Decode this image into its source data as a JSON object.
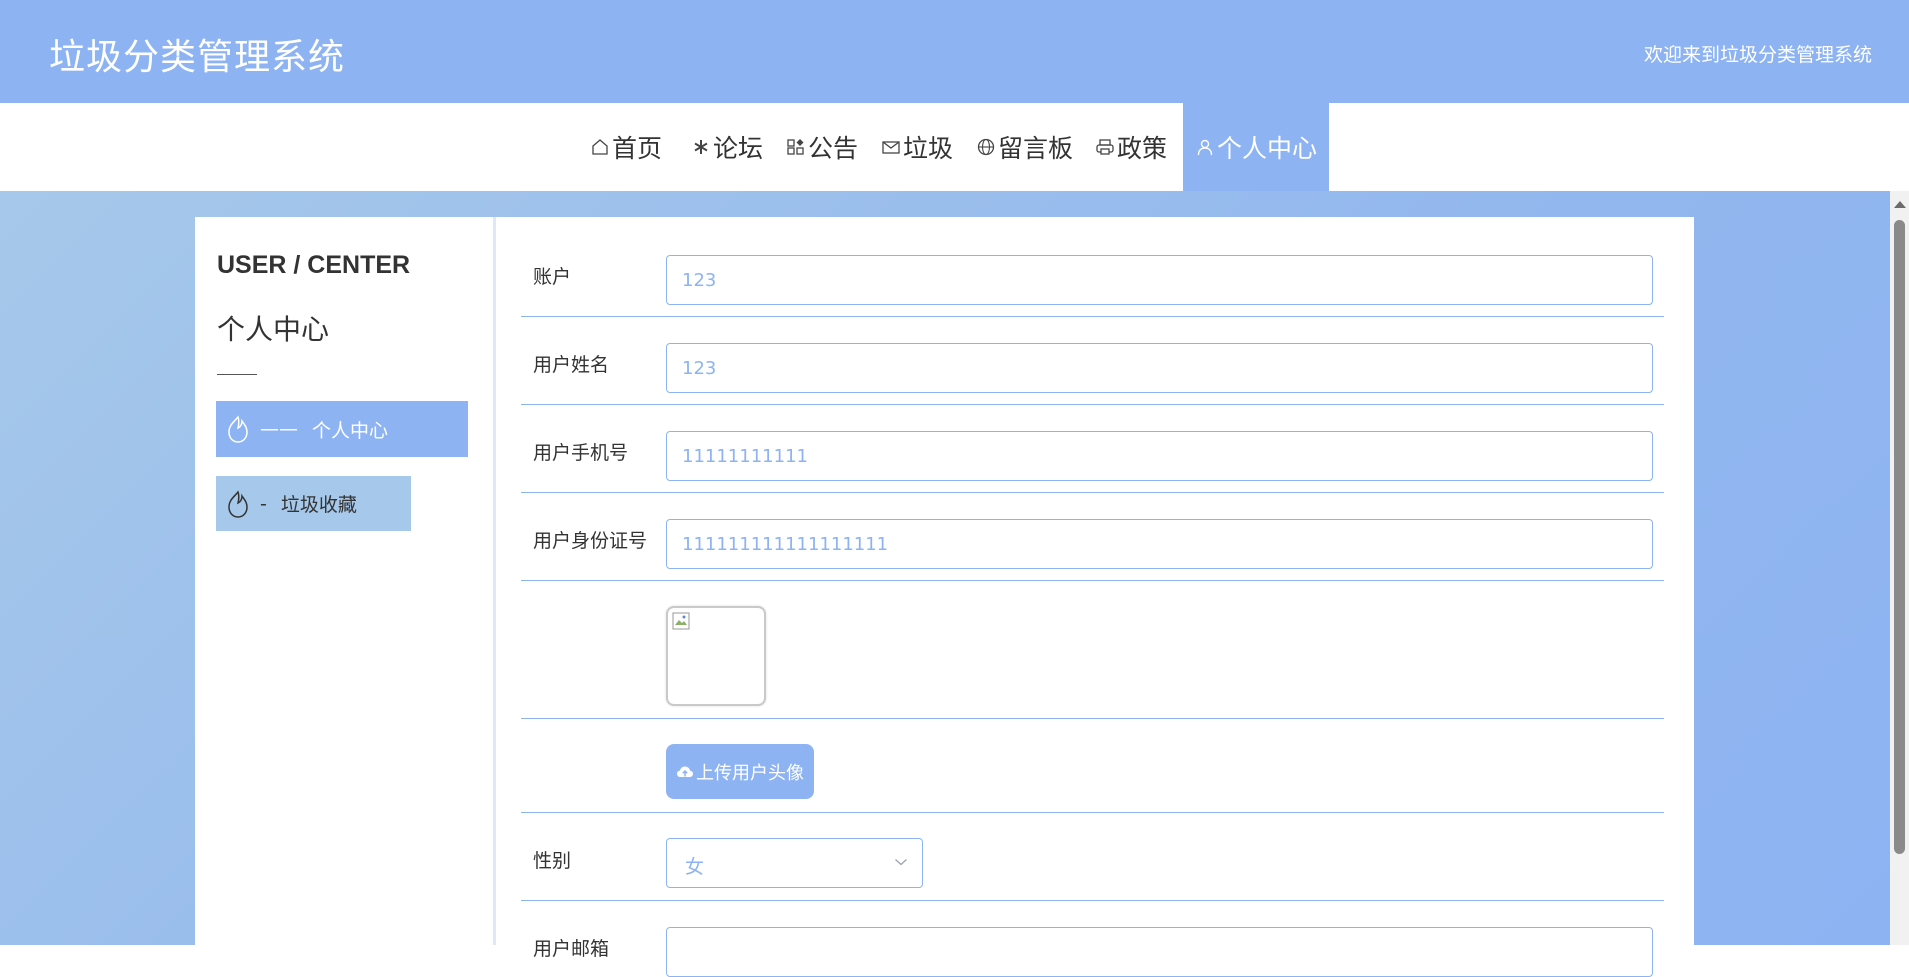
{
  "header": {
    "title": "垃圾分类管理系统",
    "welcome": "欢迎来到垃圾分类管理系统"
  },
  "nav": {
    "items": [
      {
        "label": "首页",
        "icon": "home-icon"
      },
      {
        "label": "论坛",
        "icon": "snowflake-icon"
      },
      {
        "label": "公告",
        "icon": "grid-icon"
      },
      {
        "label": "垃圾",
        "icon": "mail-icon"
      },
      {
        "label": "留言板",
        "icon": "globe-icon"
      },
      {
        "label": "政策",
        "icon": "printer-icon"
      },
      {
        "label": "个人中心",
        "icon": "user-icon"
      }
    ],
    "active_index": 6
  },
  "sidebar": {
    "title_en": "USER / CENTER",
    "title_cn": "个人中心",
    "items": [
      {
        "prefix": "——",
        "label": "个人中心",
        "icon": "flame-icon"
      },
      {
        "prefix": "-",
        "label": "垃圾收藏",
        "icon": "flame-icon"
      }
    ]
  },
  "form": {
    "fields": [
      {
        "label": "账户",
        "value": "123"
      },
      {
        "label": "用户姓名",
        "value": "123"
      },
      {
        "label": "用户手机号",
        "value": "11111111111"
      },
      {
        "label": "用户身份证号",
        "value": "111111111111111111"
      }
    ],
    "upload_label": "上传用户头像",
    "gender": {
      "label": "性别",
      "value": "女"
    },
    "email": {
      "label": "用户邮箱",
      "value": ""
    }
  },
  "colors": {
    "primary": "#8db3f2",
    "secondary": "#a6c8ea",
    "text": "#333333"
  }
}
